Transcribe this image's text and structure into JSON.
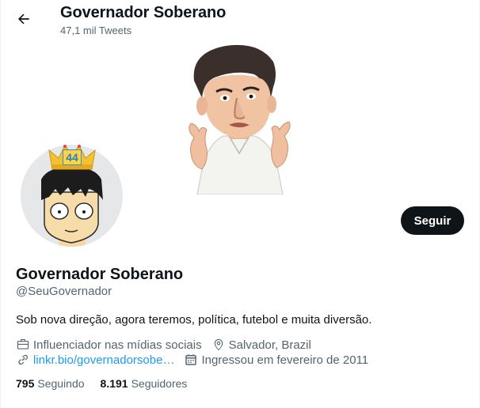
{
  "header": {
    "title": "Governador Soberano",
    "tweet_count": "47,1 mil Tweets"
  },
  "profile": {
    "name": "Governador Soberano",
    "handle": "@SeuGovernador",
    "bio": "Sob nova direção, agora teremos, política, futebol e muita diversão.",
    "category": "Influenciador nas mídias sociais",
    "location": "Salvador, Brazil",
    "link": "linkr.bio/governadorsobe…",
    "joined": "Ingressou em fevereiro de 2011",
    "avatar_badge": "44"
  },
  "actions": {
    "follow_label": "Seguir"
  },
  "stats": {
    "following_count": "795",
    "following_label": "Seguindo",
    "followers_count": "8.191",
    "followers_label": "Seguidores"
  },
  "colors": {
    "accent": "#1d9bf0",
    "text": "#0f1419",
    "secondary": "#536471",
    "button": "#0f1419"
  },
  "icons": [
    "back-arrow-icon",
    "briefcase-icon",
    "location-pin-icon",
    "link-icon",
    "calendar-icon"
  ]
}
